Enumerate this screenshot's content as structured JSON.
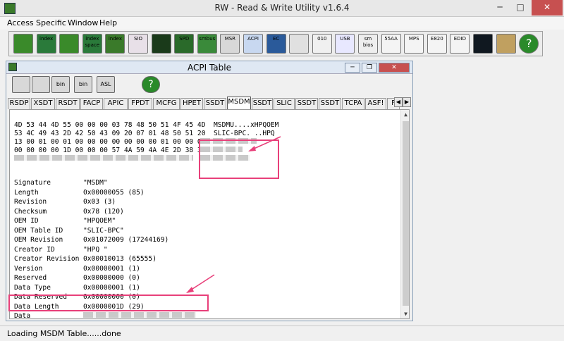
{
  "window": {
    "title": "RW - Read & Write Utility v1.6.4"
  },
  "menu": [
    "Access",
    "Specific",
    "Window",
    "Help"
  ],
  "toolbar": [
    {
      "icon": "pci-icon",
      "label": ""
    },
    {
      "icon": "index-icon",
      "label": "index"
    },
    {
      "icon": "memory-icon",
      "label": ""
    },
    {
      "icon": "index-space-icon",
      "label": "index space"
    },
    {
      "icon": "index-data-icon",
      "label": "index"
    },
    {
      "icon": "sio-icon",
      "label": "SIO"
    },
    {
      "icon": "wave-icon",
      "label": ""
    },
    {
      "icon": "spd-icon",
      "label": "SPD"
    },
    {
      "icon": "smbus-icon",
      "label": "smbus"
    },
    {
      "icon": "msr-icon",
      "label": "MSR"
    },
    {
      "icon": "acpi-icon",
      "label": "ACPI"
    },
    {
      "icon": "ec-icon",
      "label": "EC"
    },
    {
      "icon": "cmos-icon",
      "label": ""
    },
    {
      "icon": "io-icon",
      "label": "010"
    },
    {
      "icon": "usb-icon",
      "label": "USB"
    },
    {
      "icon": "smbios-icon",
      "label": "sm bios"
    },
    {
      "icon": "55aa-icon",
      "label": "55AA"
    },
    {
      "icon": "mps-icon",
      "label": "MPS"
    },
    {
      "icon": "e820-icon",
      "label": "E820"
    },
    {
      "icon": "edid-icon",
      "label": "EDID"
    },
    {
      "icon": "command-icon",
      "label": ""
    },
    {
      "icon": "stop-icon",
      "label": ""
    },
    {
      "icon": "help-icon",
      "label": "?"
    }
  ],
  "child": {
    "title": "ACPI Table",
    "tools": [
      {
        "icon": "save-icon",
        "label": ""
      },
      {
        "icon": "save-all-icon",
        "label": ""
      },
      {
        "icon": "bin-icon",
        "label": "bin"
      },
      {
        "icon": "bin-all-icon",
        "label": "bin"
      },
      {
        "icon": "asl-icon",
        "label": "ASL"
      },
      {
        "icon": "binoculars-icon",
        "label": ""
      },
      {
        "icon": "help-icon",
        "label": "?"
      }
    ],
    "tabs": [
      "RSDP",
      "XSDT",
      "RSDT",
      "FACP",
      "APIC",
      "FPDT",
      "MCFG",
      "HPET",
      "SSDT",
      "MSDM",
      "SSDT",
      "SLIC",
      "SSDT",
      "SSDT",
      "TCPA",
      "ASF!",
      "F"
    ],
    "active_tab_index": 9
  },
  "hex": [
    "4D 53 44 4D 55 00 00 00 03 78 48 50 51 4F 45 4D  MSDMU....xHPQOEM",
    "53 4C 49 43 2D 42 50 43 09 20 07 01 48 50 51 20  SLIC-BPC. ..HPQ",
    "13 00 01 00 01 00 00 00 00 00 00 00 01 00 00 00",
    "00 00 00 00 1D 00 00 00 57 4A 59 4A 4E 2D 38 38"
  ],
  "fields": [
    {
      "name": "Signature",
      "value": "\"MSDM\""
    },
    {
      "name": "Length",
      "value": "0x00000055 (85)"
    },
    {
      "name": "Revision",
      "value": "0x03 (3)"
    },
    {
      "name": "Checksum",
      "value": "0x78 (120)"
    },
    {
      "name": "OEM ID",
      "value": "\"HPQOEM\""
    },
    {
      "name": "OEM Table ID",
      "value": "\"SLIC-BPC\""
    },
    {
      "name": "OEM Revision",
      "value": "0x01072009 (17244169)"
    },
    {
      "name": "Creator ID",
      "value": "\"HPQ \""
    },
    {
      "name": "Creator Revision",
      "value": "0x00010013 (65555)"
    },
    {
      "name": "Version",
      "value": "0x00000001 (1)"
    },
    {
      "name": "Reserved",
      "value": "0x00000000 (0)"
    },
    {
      "name": "Data Type",
      "value": "0x00000001 (1)"
    },
    {
      "name": "Data Reserved",
      "value": "0x00000000 (0)"
    },
    {
      "name": "Data Length",
      "value": "0x0000001D (29)"
    },
    {
      "name": "Data",
      "value": ""
    }
  ],
  "status": "Loading MSDM Table......done",
  "colors": {
    "highlight": "#e8407a",
    "close": "#c75050"
  }
}
